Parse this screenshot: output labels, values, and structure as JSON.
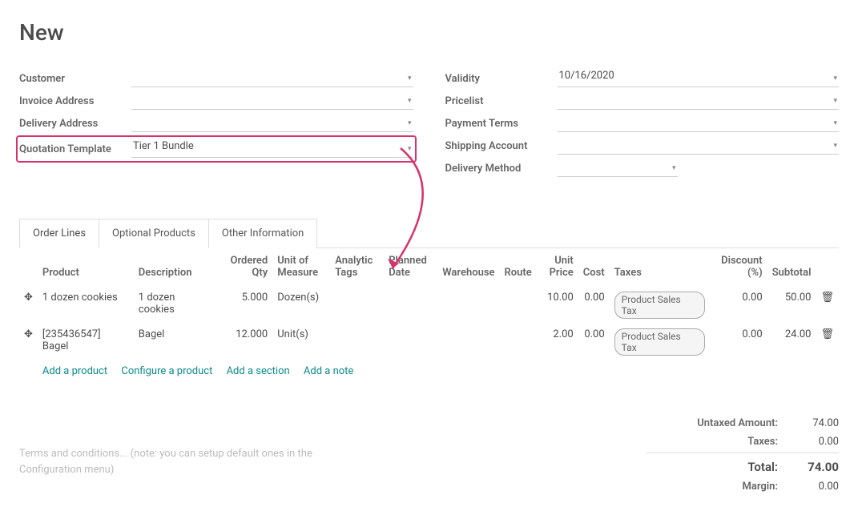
{
  "title": "New",
  "left_form": {
    "customer_label": "Customer",
    "customer_value": "",
    "invoice_label": "Invoice Address",
    "invoice_value": "",
    "delivery_label": "Delivery Address",
    "delivery_value": "",
    "template_label": "Quotation Template",
    "template_value": "Tier 1 Bundle"
  },
  "right_form": {
    "validity_label": "Validity",
    "validity_value": "10/16/2020",
    "pricelist_label": "Pricelist",
    "pricelist_value": "",
    "payment_label": "Payment Terms",
    "payment_value": "",
    "shipping_label": "Shipping Account",
    "shipping_value": "",
    "delivery_method_label": "Delivery Method",
    "delivery_method_value": ""
  },
  "tabs": {
    "order_lines": "Order Lines",
    "optional": "Optional Products",
    "other": "Other Information"
  },
  "columns": {
    "product": "Product",
    "description": "Description",
    "qty": "Ordered Qty",
    "uom": "Unit of Measure",
    "tags": "Analytic Tags",
    "planned": "Planned Date",
    "warehouse": "Warehouse",
    "route": "Route",
    "unit_price": "Unit Price",
    "cost": "Cost",
    "taxes": "Taxes",
    "discount": "Discount (%)",
    "subtotal": "Subtotal"
  },
  "lines": [
    {
      "product": "1 dozen cookies",
      "description": "1 dozen cookies",
      "qty": "5.000",
      "uom": "Dozen(s)",
      "unit_price": "10.00",
      "cost": "0.00",
      "tax": "Product Sales Tax",
      "discount": "0.00",
      "subtotal": "50.00"
    },
    {
      "product": "[235436547] Bagel",
      "description": "Bagel",
      "qty": "12.000",
      "uom": "Unit(s)",
      "unit_price": "2.00",
      "cost": "0.00",
      "tax": "Product Sales Tax",
      "discount": "0.00",
      "subtotal": "24.00"
    }
  ],
  "actions": {
    "add_product": "Add a product",
    "configure": "Configure a product",
    "add_section": "Add a section",
    "add_note": "Add a note"
  },
  "terms_placeholder": "Terms and conditions... (note: you can setup default ones in the Configuration menu)",
  "totals": {
    "untaxed_label": "Untaxed Amount:",
    "untaxed_value": "74.00",
    "taxes_label": "Taxes:",
    "taxes_value": "0.00",
    "total_label": "Total:",
    "total_value": "74.00",
    "margin_label": "Margin:",
    "margin_value": "0.00"
  }
}
